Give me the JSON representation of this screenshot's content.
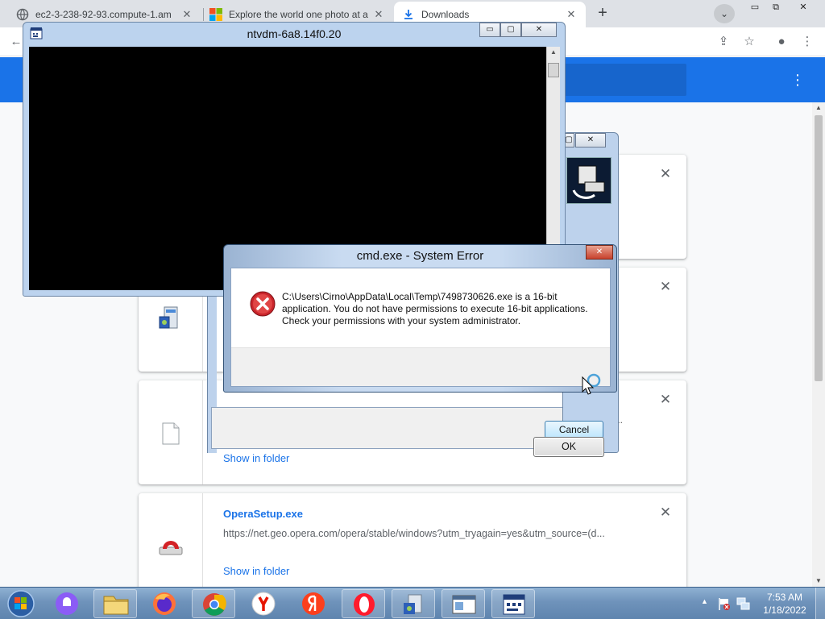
{
  "browser": {
    "tabs": [
      {
        "label": "ec2-3-238-92-93.compute-1.am",
        "icon": "globe-icon",
        "close": "✕"
      },
      {
        "label": "Explore the world one photo at a",
        "icon": "microsoft-logo-icon",
        "close": "✕"
      },
      {
        "label": "Downloads",
        "icon": "download-icon",
        "close": "✕"
      }
    ],
    "new_tab": "+",
    "tab_search": "⌄",
    "window_controls": {
      "minimize": "▭",
      "restore": "⧉",
      "close": "✕"
    },
    "toolbar": {
      "back": "←",
      "share": "⇪",
      "bookmark": "☆",
      "profile": "●",
      "menu": "⋮"
    }
  },
  "downloads": {
    "menu": "⋮",
    "items": [
      {
        "name": "",
        "url": "",
        "show_in_folder": "",
        "remove": "✕"
      },
      {
        "name": "",
        "url": "",
        "show_in_folder": "",
        "remove": "✕"
      },
      {
        "name": "",
        "url": "",
        "show_in_folder": "Show in folder",
        "remove": "✕"
      },
      {
        "name": "OperaSetup.exe",
        "url": "https://net.geo.opera.com/opera/stable/windows?utm_tryagain=yes&utm_source=(d...",
        "show_in_folder": "Show in folder",
        "remove": "✕"
      }
    ]
  },
  "ntvdm": {
    "title": "ntvdm-6a8.14f0.20",
    "controls": {
      "minimize": "▭",
      "maximize": "▢",
      "close": "✕"
    }
  },
  "background_dialog": {
    "close": "✕",
    "cancel": "Cancel",
    "ellipsis": "..."
  },
  "error_dialog": {
    "title": "cmd.exe - System Error",
    "message": "C:\\Users\\Cirno\\AppData\\Local\\Temp\\7498730626.exe is a 16-bit application. You do not have permissions to execute 16-bit applications. Check your permissions with your system administrator.",
    "ok": "OK",
    "close": "✕"
  },
  "taskbar": {
    "clock_time": "7:53 AM",
    "clock_date": "1/18/2022",
    "tray_arrow": "▲"
  }
}
